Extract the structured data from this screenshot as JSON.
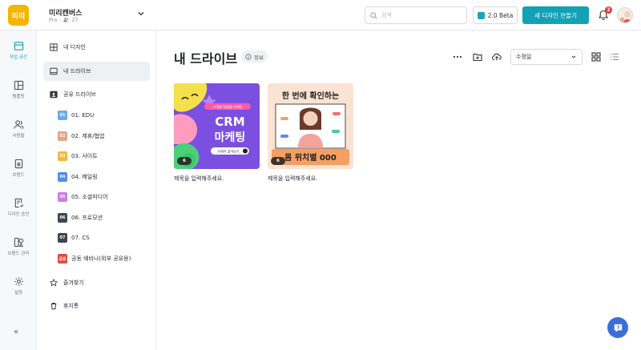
{
  "workspace": {
    "logo_text": "미리",
    "name": "미리캔버스",
    "plan": "Pro",
    "members": "27"
  },
  "header": {
    "search_placeholder": "검색",
    "beta_label": "2.0 Beta",
    "new_design_label": "새 디자인 만들기",
    "notification_count": "2"
  },
  "rail": [
    {
      "label": "작업 공간",
      "icon": "workspace-icon",
      "active": true
    },
    {
      "label": "템플릿",
      "icon": "template-icon"
    },
    {
      "label": "사람들",
      "icon": "people-icon"
    },
    {
      "label": "브랜드",
      "icon": "brand-icon"
    },
    {
      "label": "디자인 승인",
      "icon": "approval-icon"
    },
    {
      "label": "브랜드 관리",
      "icon": "brand-manage-icon"
    },
    {
      "label": "설정",
      "icon": "settings-icon"
    }
  ],
  "sidebar": {
    "my_design": "내 디자인",
    "my_drive": "내 드라이브",
    "shared_drive": "공유 드라이브",
    "folders": [
      {
        "badge": "01",
        "label": "01. EDU",
        "color": "#6aa9e9"
      },
      {
        "badge": "02",
        "label": "02. 제휴/협업",
        "color": "#e8a488"
      },
      {
        "badge": "03",
        "label": "03. 사이트",
        "color": "#f6b73c"
      },
      {
        "badge": "04",
        "label": "04. 메일링",
        "color": "#4e8fe8"
      },
      {
        "badge": "05",
        "label": "05. 소셜미디어",
        "color": "#c87ee0"
      },
      {
        "badge": "06",
        "label": "06. 프로모션",
        "color": "#3f4450"
      },
      {
        "badge": "07",
        "label": "07. CS",
        "color": "#3f4450"
      },
      {
        "badge": "공유",
        "label": "공동 웨비나(외부 공유용)",
        "color": "#e5483d"
      }
    ],
    "favorites": "즐겨찾기",
    "trash": "휴지통"
  },
  "main": {
    "title": "내 드라이브",
    "info_label": "정보",
    "sort_value": "수정일",
    "cards": [
      {
        "title": "제목을 입력해주세요.",
        "pages": "6",
        "thumb_small": "고객별 맞춤형 마케팅",
        "thumb_big1": "CRM",
        "thumb_big2": "마케팅",
        "thumb_cta": "자세히 알아보기"
      },
      {
        "title": "제목을 입력해주세요.",
        "pages": "6",
        "thumb_top": "한 번에 확인하는",
        "thumb_bottom": "몸 위치별 000"
      }
    ]
  },
  "colors": {
    "accent": "#12a2b5",
    "help": "#3b6fd8"
  }
}
